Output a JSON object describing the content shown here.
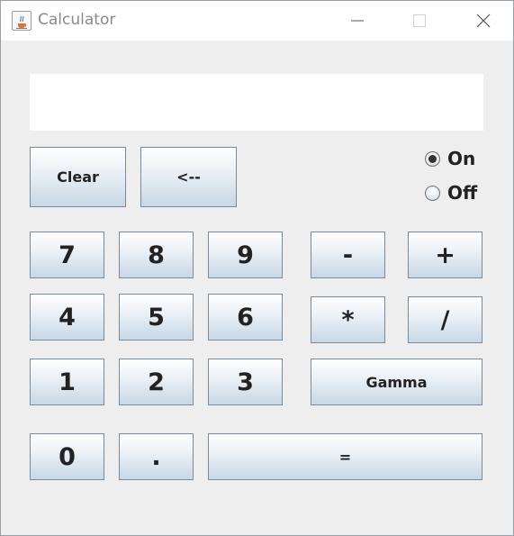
{
  "window": {
    "title": "Calculator"
  },
  "display": {
    "value": ""
  },
  "controls": {
    "clear_label": "Clear",
    "backspace_label": "<--"
  },
  "power": {
    "on_label": "On",
    "off_label": "Off",
    "selected": "On"
  },
  "keys": {
    "k7": "7",
    "k8": "8",
    "k9": "9",
    "k4": "4",
    "k5": "5",
    "k6": "6",
    "k1": "1",
    "k2": "2",
    "k3": "3",
    "k0": "0",
    "dot": ".",
    "equals": "=",
    "minus": "-",
    "plus": "+",
    "multiply": "*",
    "divide": "/",
    "gamma": "Gamma"
  },
  "icons": {
    "app": "java-coffee-icon",
    "minimize": "minimize-icon",
    "maximize": "maximize-icon",
    "close": "close-icon"
  }
}
